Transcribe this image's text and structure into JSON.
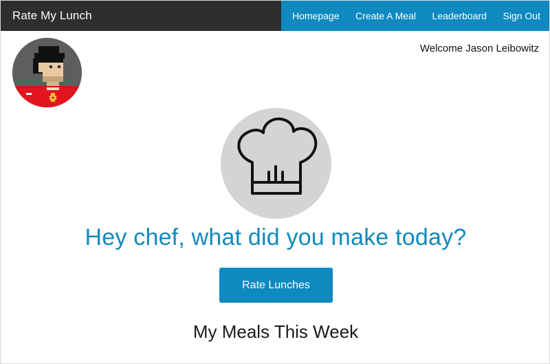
{
  "navbar": {
    "brand": "Rate My Lunch",
    "links": [
      {
        "label": "Homepage"
      },
      {
        "label": "Create A Meal"
      },
      {
        "label": "Leaderboard"
      },
      {
        "label": "Sign Out"
      }
    ]
  },
  "user": {
    "welcome": "Welcome Jason Leibowitz",
    "avatar_icon": "pixel-art-avatar-icon"
  },
  "hero": {
    "icon": "chef-hat-icon",
    "headline": "Hey chef, what did you make today?",
    "button_label": "Rate Lunches"
  },
  "meals": {
    "title": "My Meals This Week"
  },
  "colors": {
    "accent": "#0f8ac0",
    "brand_bar": "#2e2e2e",
    "headline": "#1189bd",
    "icon_circle": "#d4d4d4"
  }
}
